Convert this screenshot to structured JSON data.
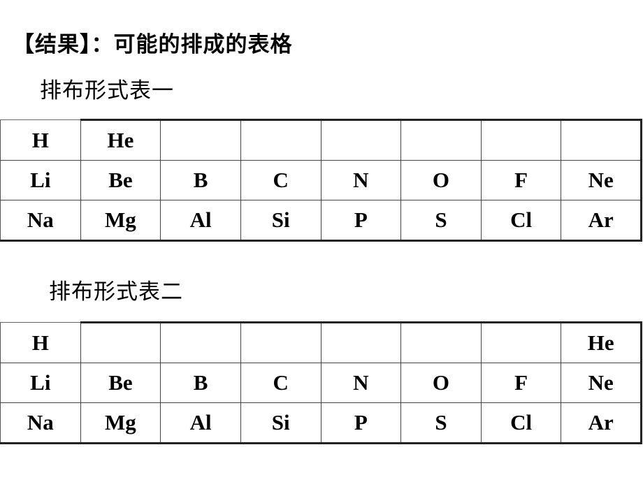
{
  "heading": "【结果】：可能的排成的表格",
  "tables": [
    {
      "title": "排布形式表一",
      "rows": [
        [
          "H",
          "He",
          "",
          "",
          "",
          "",
          "",
          ""
        ],
        [
          "Li",
          "Be",
          "B",
          "C",
          "N",
          "O",
          "F",
          "Ne"
        ],
        [
          "Na",
          "Mg",
          "Al",
          "Si",
          "P",
          "S",
          "Cl",
          "Ar"
        ]
      ]
    },
    {
      "title": "排布形式表二",
      "rows": [
        [
          "H",
          "",
          "",
          "",
          "",
          "",
          "",
          "He"
        ],
        [
          "Li",
          "Be",
          "B",
          "C",
          "N",
          "O",
          "F",
          "Ne"
        ],
        [
          "Na",
          "Mg",
          "Al",
          "Si",
          "P",
          "S",
          "Cl",
          "Ar"
        ]
      ]
    }
  ]
}
